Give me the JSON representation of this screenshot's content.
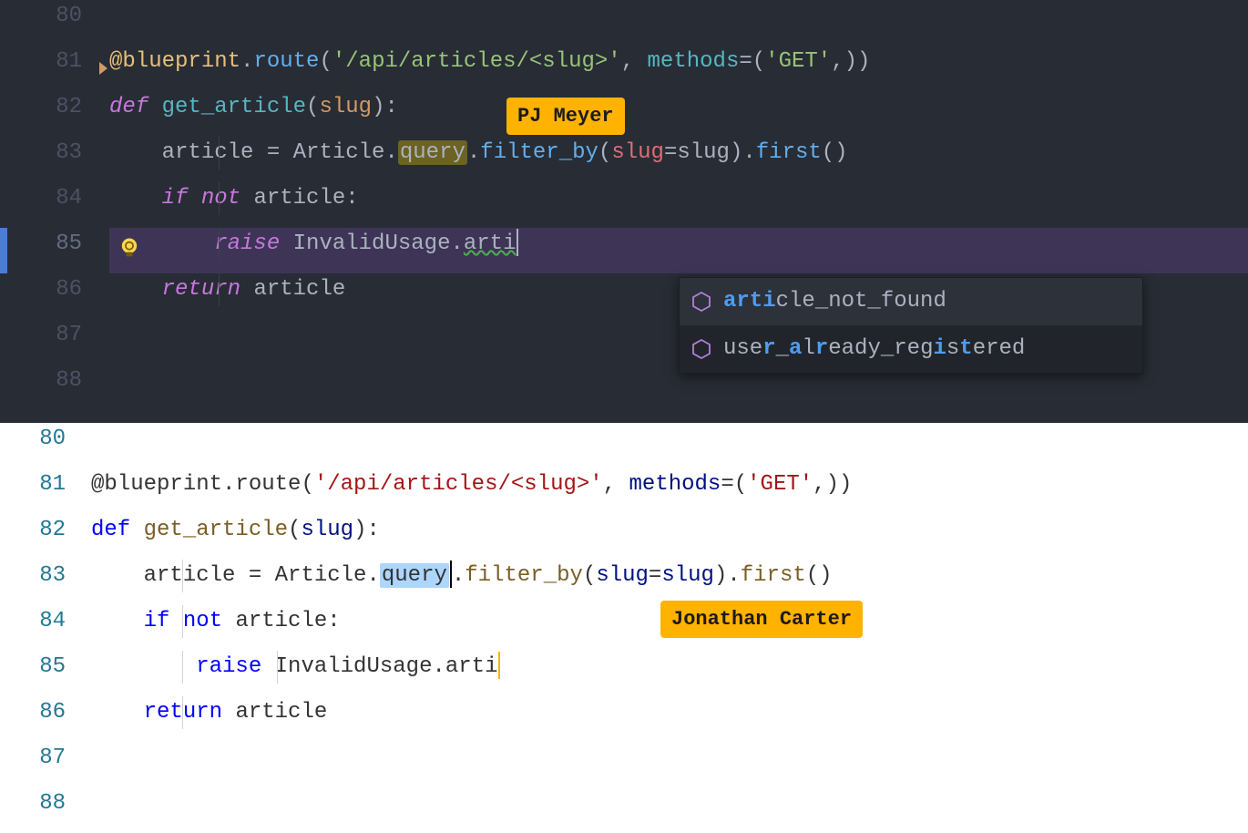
{
  "dark": {
    "collab_name": "PJ Meyer",
    "lines": {
      "80": "",
      "81": {
        "decor": "@blueprint",
        "dot": ".",
        "route": "route",
        "lp": "(",
        "str": "'/api/articles/<slug>'",
        "comma": ", ",
        "kwarg": "methods",
        "eq": "=",
        "lp2": "(",
        "str2": "'GET'",
        "tail": ",))"
      },
      "82": {
        "def": "def ",
        "fn": "get_article",
        "lp": "(",
        "param": "slug",
        "rp": "):"
      },
      "83": {
        "indent": "    ",
        "lhs": "article ",
        "eq": "= ",
        "cls": "Article",
        "dot": ".",
        "query": "query",
        "dot2": ".",
        "filter": "filter_by",
        "lp": "(",
        "kw": "slug",
        "eq2": "=",
        "arg": "slug",
        "rp": ").",
        "first": "first",
        "tail": "()"
      },
      "84": {
        "indent": "    ",
        "if": "if ",
        "not": "not ",
        "id": "article",
        "colon": ":"
      },
      "85": {
        "indent": "        ",
        "raise": "raise ",
        "cls": "InvalidUsage",
        "dot": ".",
        "partial": "arti"
      },
      "86": {
        "indent": "    ",
        "ret": "return ",
        "id": "article"
      },
      "87": "",
      "88": ""
    },
    "autocomplete": [
      {
        "pre": "arti",
        "rest": "cle_not_found",
        "selected": true
      },
      {
        "full": "user_already_registered",
        "segs": [
          {
            "t": "use",
            "m": false
          },
          {
            "t": "r",
            "m": true
          },
          {
            "t": "_",
            "m": false
          },
          {
            "t": "a",
            "m": true
          },
          {
            "t": "l",
            "m": false
          },
          {
            "t": "r",
            "m": true
          },
          {
            "t": "eady_reg",
            "m": false
          },
          {
            "t": "i",
            "m": true
          },
          {
            "t": "s",
            "m": false
          },
          {
            "t": "t",
            "m": true
          },
          {
            "t": "ered",
            "m": false
          }
        ],
        "selected": false
      }
    ]
  },
  "light": {
    "collab_name": "Jonathan Carter",
    "lines": {
      "80": "",
      "81": {
        "decor": "@blueprint.route",
        "lp": "(",
        "str": "'/api/articles/<slug>'",
        "comma": ", ",
        "kwarg": "methods",
        "eq": "=(",
        "str2": "'GET'",
        "tail": ",))"
      },
      "82": {
        "def": "def ",
        "fn": "get_article",
        "lp": "(",
        "param": "slug",
        "rp": "):"
      },
      "83": {
        "indent": "    ",
        "lhs": "article = Article.",
        "query": "query",
        "dot": ".",
        "filter": "filter_by",
        "lp": "(",
        "kw": "slug",
        "eq": "=",
        "arg": "slug",
        "rp": ").",
        "first": "first",
        "tail": "()"
      },
      "84": {
        "indent": "    ",
        "if": "if ",
        "not": "not ",
        "id": "article:"
      },
      "85": {
        "indent": "        ",
        "raise": "raise ",
        "cls": "InvalidUsage.arti"
      },
      "86": {
        "indent": "    ",
        "ret": "return ",
        "id": "article"
      },
      "87": "",
      "88": ""
    }
  },
  "icons": {
    "bulb": "lightbulb-icon",
    "cube": "symbol-method-icon"
  }
}
